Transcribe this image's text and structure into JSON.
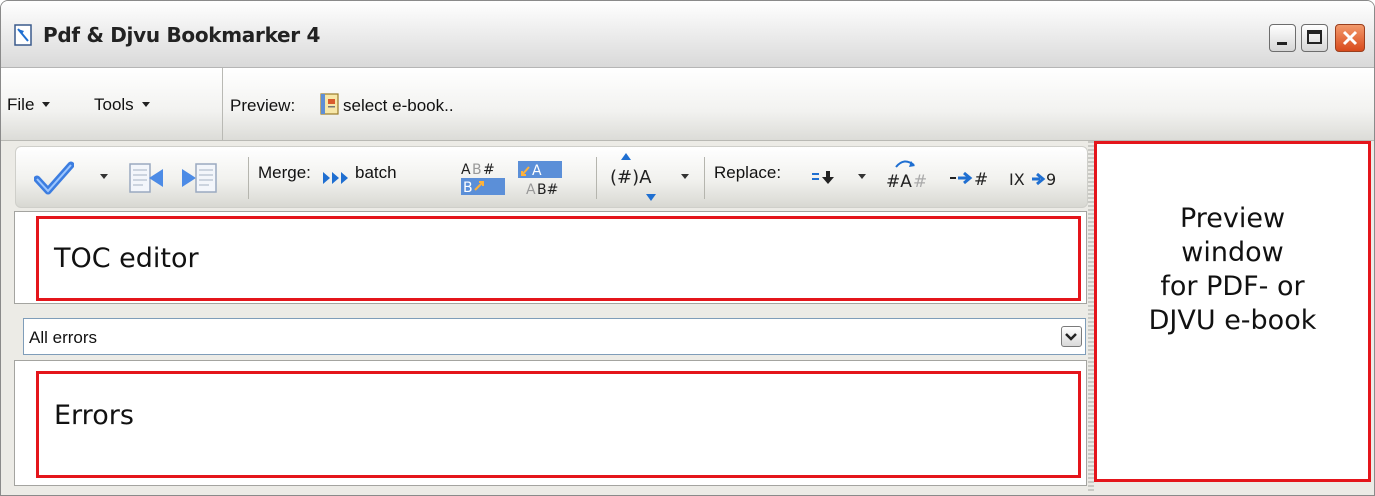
{
  "window": {
    "title": "Pdf & Djvu Bookmarker 4"
  },
  "menu": {
    "file_label": "File",
    "tools_label": "Tools",
    "preview_label": "Preview:",
    "select_book_label": "select e-book.."
  },
  "toolbar": {
    "merge_label": "Merge:",
    "batch_label": "batch",
    "replace_label": "Replace:",
    "hash_paren_label": "(#)A",
    "icons": [
      "checkmark-icon",
      "move-left-icon",
      "move-right-icon",
      "batch-arrows-icon",
      "merge-ab-icon",
      "merge-ab2-icon",
      "numbering-icon",
      "replace-down-icon",
      "replace-hash-icon",
      "arrow-hash-icon",
      "roman-to-arabic-icon"
    ],
    "arrow_hash_text": "-→#",
    "ix_text": "IX",
    "nine_text": "9"
  },
  "toc_editor": {
    "label": "TOC editor"
  },
  "errors_filter": {
    "value": "All errors"
  },
  "errors": {
    "label": "Errors"
  },
  "preview_pane": {
    "lines": [
      "Preview",
      "window",
      "for PDF- or",
      "DJVU e-book"
    ]
  },
  "colors": {
    "highlight_border": "#e4151b",
    "accent_blue": "#1f6fd1"
  }
}
